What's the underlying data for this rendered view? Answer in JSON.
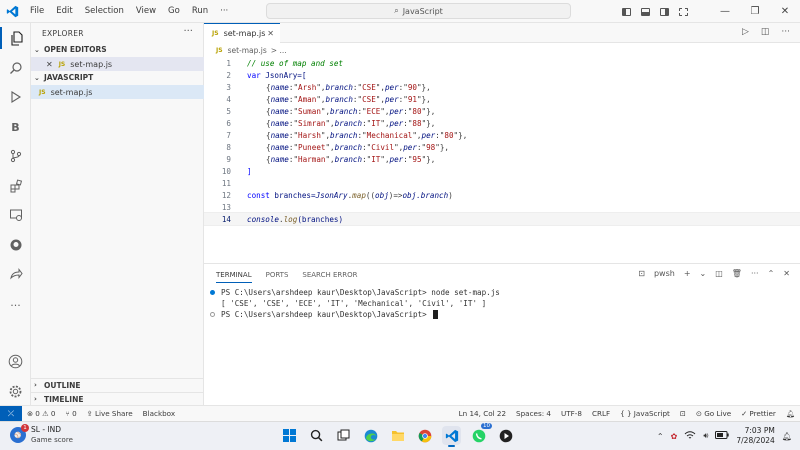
{
  "menu": [
    "File",
    "Edit",
    "Selection",
    "View",
    "Go",
    "Run"
  ],
  "menu_more": "···",
  "search": {
    "text": "JavaScript"
  },
  "sidebar": {
    "title": "EXPLORER",
    "more": "···",
    "open_editors_label": "OPEN EDITORS",
    "open_editor_file": "set-map.js",
    "folder_label": "JAVASCRIPT",
    "folder_file": "set-map.js",
    "outline_label": "OUTLINE",
    "timeline_label": "TIMELINE",
    "js_badge": "JS"
  },
  "editor": {
    "tab_label": "set-map.js",
    "breadcrumb_file": "set-map.js",
    "breadcrumb_rest": "> ...",
    "line_numbers": [
      "1",
      "2",
      "3",
      "4",
      "5",
      "6",
      "7",
      "8",
      "9",
      "10",
      "11",
      "12",
      "13",
      "14"
    ],
    "current_line": 14
  },
  "code": {
    "l1": "// use of map and set",
    "l2_kw": "var",
    "l2_name": " JsonAry=[",
    "rows": [
      {
        "name": "Arsh",
        "branch": "CSE",
        "per": "90"
      },
      {
        "name": "Aman",
        "branch": "CSE",
        "per": "91"
      },
      {
        "name": "Suman",
        "branch": "ECE",
        "per": "80"
      },
      {
        "name": "Simran",
        "branch": "IT",
        "per": "88"
      },
      {
        "name": "Harsh",
        "branch": "Mechanical",
        "per": "80"
      },
      {
        "name": "Puneet",
        "branch": "Civil",
        "per": "98"
      },
      {
        "name": "Harman",
        "branch": "IT",
        "per": "95"
      }
    ],
    "l10": "]",
    "l12_kw": "const",
    "l12_a": " branches=",
    "l12_obj": "JsonAry",
    "l12_dot": ".",
    "l12_fn": "map",
    "l12_b": "((",
    "l12_param": "obj",
    "l12_c": ")=>",
    "l12_d": "obj.branch",
    "l12_e": ")",
    "l14_obj": "console",
    "l14_dot": ".",
    "l14_fn": "log",
    "l14_rest": "(branches)"
  },
  "panel": {
    "tabs": [
      "TERMINAL",
      "PORTS",
      "SEARCH ERROR"
    ],
    "shell": "pwsh",
    "plus": "+",
    "lines": [
      "PS C:\\Users\\arshdeep kaur\\Desktop\\JavaScript> node set-map.js",
      "[ 'CSE', 'CSE', 'ECE', 'IT', 'Mechanical', 'Civil', 'IT' ]",
      "PS C:\\Users\\arshdeep kaur\\Desktop\\JavaScript> "
    ]
  },
  "status": {
    "problems": "⊗ 0 ⚠ 0",
    "ports": "⑂ 0",
    "live_share": "Live Share",
    "blackbox": "Blackbox",
    "position": "Ln 14, Col 22",
    "spaces": "Spaces: 4",
    "encoding": "UTF-8",
    "eol": "CRLF",
    "language": "{ } JavaScript",
    "golive": "Go Live",
    "prettier": "✓ Prettier"
  },
  "taskbar": {
    "weather_title": "SL - IND",
    "weather_sub": "Game score",
    "weather_badge": "1",
    "whatsapp_badge": "10",
    "time": "7:03 PM",
    "date": "7/28/2024"
  },
  "colors": {
    "accent": "#005fb8",
    "comment": "#008000",
    "keyword": "#0000ff",
    "string": "#a31515",
    "property": "#e50000"
  }
}
